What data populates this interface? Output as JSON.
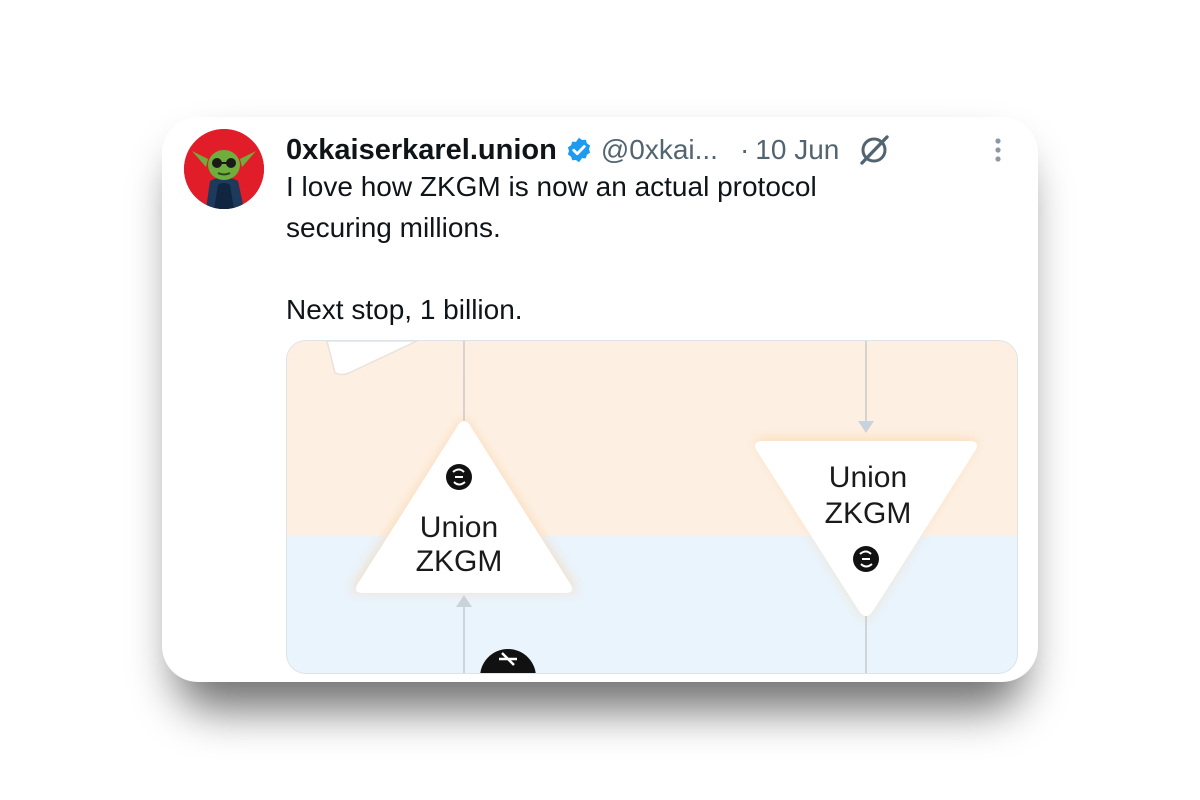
{
  "tweet": {
    "display_name": "0xkaiserkarel.union",
    "handle": "@0xkai...",
    "separator": "·",
    "date": "10 Jun",
    "text_lines": [
      "I love how ZKGM is now an actual protocol",
      "securing millions.",
      "Next stop, 1 billion."
    ]
  },
  "icons": {
    "verified": "verified-badge-icon",
    "grok": "grok-icon",
    "more": "more-options-icon",
    "avatar": "avatar"
  },
  "media": {
    "left_node": {
      "line1": "Union",
      "line2": "ZKGM"
    },
    "right_node": {
      "line1": "Union",
      "line2": "ZKGM"
    }
  },
  "colors": {
    "verified_blue": "#1d9bf0",
    "avatar_red": "#e11d2a",
    "text_primary": "#0f1419",
    "text_secondary": "#536471",
    "media_top_bg": "#fdf0e3",
    "media_bottom_bg": "#eaf4fc"
  }
}
